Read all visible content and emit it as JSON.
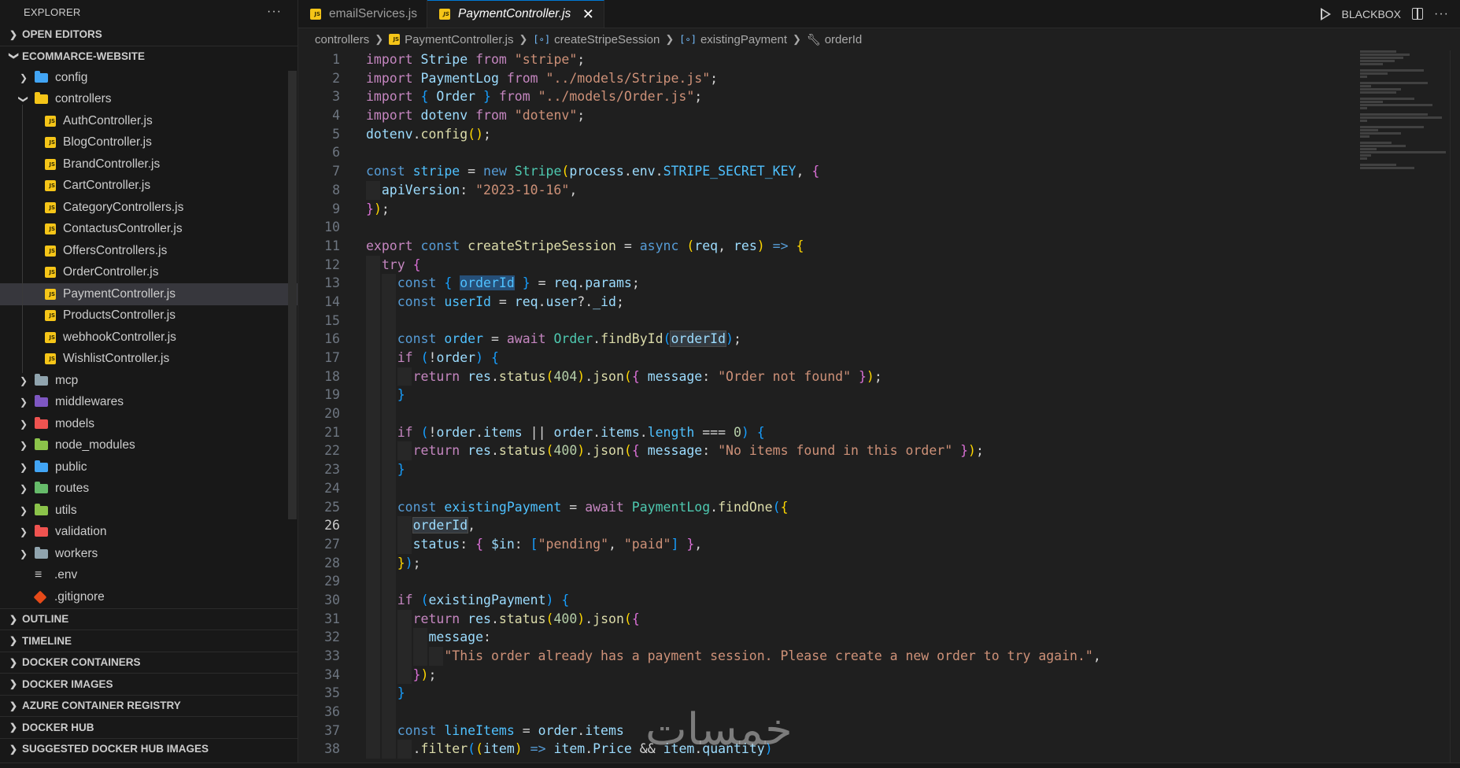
{
  "explorer": {
    "title": "EXPLORER",
    "more": "···",
    "open_editors": "OPEN EDITORS",
    "project": "ECOMMARCE-WEBSITE",
    "items": [
      {
        "label": "config",
        "type": "folder",
        "color": "#42a5f5"
      },
      {
        "label": "controllers",
        "type": "folder-open",
        "color": "#f5c518"
      },
      {
        "label": "AuthController.js",
        "type": "js"
      },
      {
        "label": "BlogController.js",
        "type": "js"
      },
      {
        "label": "BrandController.js",
        "type": "js"
      },
      {
        "label": "CartController.js",
        "type": "js"
      },
      {
        "label": "CategoryControllers.js",
        "type": "js"
      },
      {
        "label": "ContactusController.js",
        "type": "js"
      },
      {
        "label": "OffersControllers.js",
        "type": "js"
      },
      {
        "label": "OrderController.js",
        "type": "js"
      },
      {
        "label": "PaymentController.js",
        "type": "js",
        "selected": true
      },
      {
        "label": "ProductsController.js",
        "type": "js"
      },
      {
        "label": "webhookController.js",
        "type": "js"
      },
      {
        "label": "WishlistController.js",
        "type": "js"
      },
      {
        "label": "mcp",
        "type": "folder",
        "color": "#90a4ae"
      },
      {
        "label": "middlewares",
        "type": "folder",
        "color": "#7e57c2"
      },
      {
        "label": "models",
        "type": "folder",
        "color": "#ef5350"
      },
      {
        "label": "node_modules",
        "type": "folder",
        "color": "#8bc34a"
      },
      {
        "label": "public",
        "type": "folder",
        "color": "#42a5f5"
      },
      {
        "label": "routes",
        "type": "folder",
        "color": "#66bb6a"
      },
      {
        "label": "utils",
        "type": "folder",
        "color": "#8bc34a"
      },
      {
        "label": "validation",
        "type": "folder",
        "color": "#ef5350"
      },
      {
        "label": "workers",
        "type": "folder",
        "color": "#90a4ae"
      },
      {
        "label": ".env",
        "type": "env"
      },
      {
        "label": ".gitignore",
        "type": "git"
      }
    ],
    "sections": [
      "OUTLINE",
      "TIMELINE",
      "DOCKER CONTAINERS",
      "DOCKER IMAGES",
      "AZURE CONTAINER REGISTRY",
      "DOCKER HUB",
      "SUGGESTED DOCKER HUB IMAGES"
    ]
  },
  "tabs": [
    {
      "label": "emailServices.js",
      "active": false
    },
    {
      "label": "PaymentController.js",
      "active": true
    }
  ],
  "top_actions": {
    "blackbox": "BLACKBOX"
  },
  "breadcrumb": {
    "folder": "controllers",
    "file": "PaymentController.js",
    "fn": "createStripeSession",
    "var": "existingPayment",
    "prop": "orderId"
  },
  "editor": {
    "current_line": 26,
    "line_numbers": [
      1,
      2,
      3,
      4,
      5,
      6,
      7,
      8,
      9,
      10,
      11,
      12,
      13,
      14,
      15,
      16,
      17,
      18,
      19,
      20,
      21,
      22,
      23,
      24,
      25,
      26,
      27,
      28,
      29,
      30,
      31,
      32,
      33,
      34,
      35,
      36,
      37,
      38
    ]
  },
  "watermark": "خمسات",
  "colors": {
    "accent": "#0078d4",
    "selection": "#264f78",
    "js_icon": "#f5c518"
  }
}
